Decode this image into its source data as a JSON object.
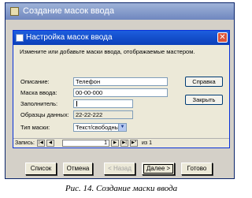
{
  "outer_window": {
    "title": "Создание масок ввода",
    "buttons": {
      "list": "Список",
      "cancel": "Отмена",
      "back": "< Назад",
      "next": "Далее >",
      "finish": "Готово"
    }
  },
  "dialog": {
    "title": "Настройка масок ввода",
    "close": "✕",
    "instruction": "Измените или добавьте маски ввода, отображаемые мастером.",
    "fields": {
      "description_label": "Описание:",
      "description_value": "Телефон",
      "mask_label": "Маска ввода:",
      "mask_value": "00-00-000",
      "placeholder_label": "Заполнитель:",
      "placeholder_value": "",
      "sample_label": "Образцы данных:",
      "sample_value": "22-22-222",
      "mask_type_label": "Тип маски:",
      "mask_type_value": "Текст/свободный"
    },
    "side_buttons": {
      "help": "Справка",
      "close": "Закрыть"
    },
    "navigation": {
      "label": "Запись:",
      "first": "|◀",
      "prev": "◀",
      "current": "1",
      "next": "▶",
      "last": "▶|",
      "new": "▶*",
      "of_text": "из 1"
    }
  },
  "caption": "Рис. 14. Создание маски ввода",
  "colors": {
    "dialog_title": "#0b3fb8",
    "outer_title": "#6f87bf",
    "close_button": "#d9533a",
    "window_bg": "#ece9d8"
  }
}
